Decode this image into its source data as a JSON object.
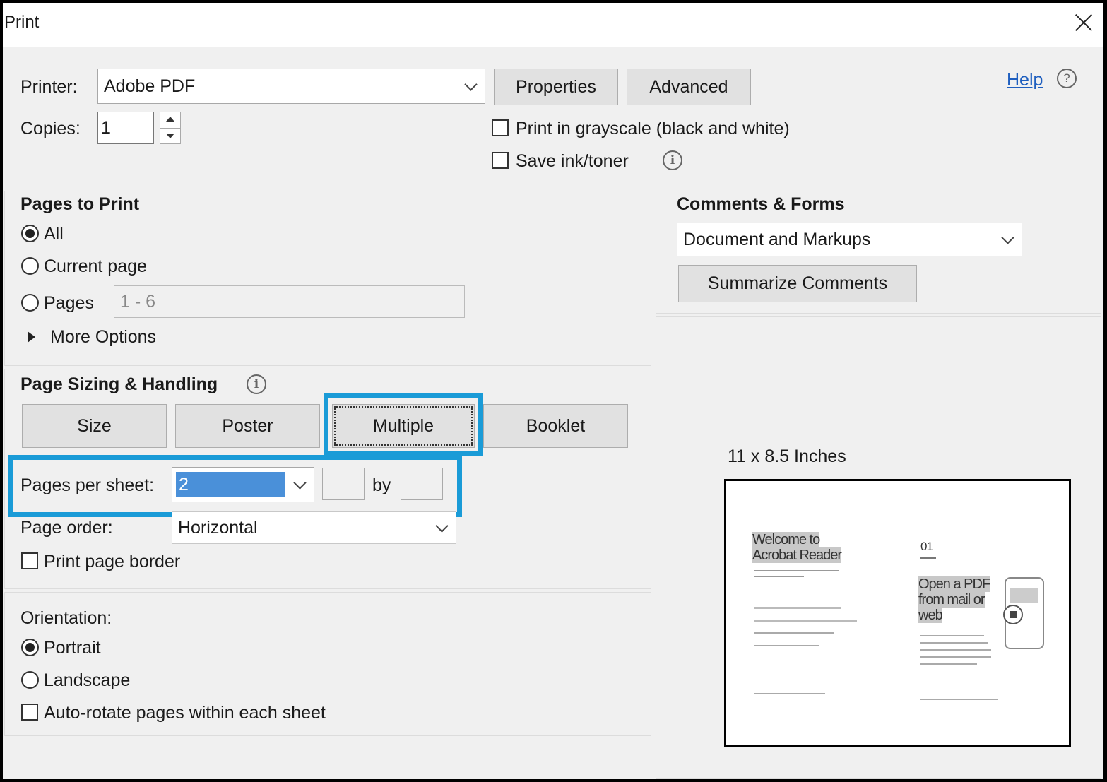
{
  "dialog": {
    "title": "Print"
  },
  "top": {
    "printer_label": "Printer:",
    "printer_value": "Adobe PDF",
    "properties_button": "Properties",
    "advanced_button": "Advanced",
    "help_link": "Help",
    "copies_label": "Copies:",
    "copies_value": "1",
    "grayscale_label": "Print in grayscale (black and white)",
    "save_ink_label": "Save ink/toner"
  },
  "pages_to_print": {
    "heading": "Pages to Print",
    "all_label": "All",
    "current_page_label": "Current page",
    "pages_label": "Pages",
    "pages_range": "1 - 6",
    "more_options_label": "More Options"
  },
  "page_sizing": {
    "heading": "Page Sizing & Handling",
    "tabs": [
      "Size",
      "Poster",
      "Multiple",
      "Booklet"
    ],
    "selected_tab": "Multiple",
    "pages_per_sheet_label": "Pages per sheet:",
    "pages_per_sheet_value": "2",
    "by_label": "by",
    "page_order_label": "Page order:",
    "page_order_value": "Horizontal",
    "print_page_border_label": "Print page border"
  },
  "orientation": {
    "heading": "Orientation:",
    "portrait_label": "Portrait",
    "landscape_label": "Landscape",
    "auto_rotate_label": "Auto-rotate pages within each sheet",
    "selected": "Portrait"
  },
  "comments_forms": {
    "heading": "Comments & Forms",
    "value": "Document and Markups",
    "summarize_button": "Summarize Comments"
  },
  "preview": {
    "size_label": "11 x 8.5 Inches",
    "left_page_title_1": "Welcome to",
    "left_page_title_2": "Acrobat Reader",
    "right_page_number": "01",
    "right_page_title_1": "Open a PDF",
    "right_page_title_2": "from mail or",
    "right_page_title_3": "web"
  },
  "colors": {
    "highlight": "#1a9bd7",
    "selection": "#4a90d9",
    "link": "#1f5fbf"
  }
}
